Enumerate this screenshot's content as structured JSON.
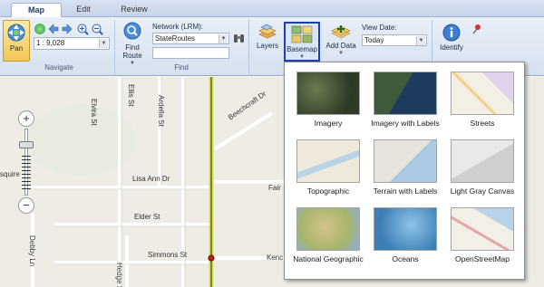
{
  "tabs": [
    {
      "label": "Map",
      "active": true
    },
    {
      "label": "Edit",
      "active": false
    },
    {
      "label": "Review",
      "active": false
    }
  ],
  "navigate": {
    "group_label": "Navigate",
    "pan_label": "Pan",
    "scale_value": "1 : 9,028"
  },
  "find": {
    "group_label": "Find",
    "network_label": "Network (LRM):",
    "network_value": "StateRoutes",
    "find_route_label": "Find Route",
    "route_value": ""
  },
  "toolbar": {
    "layers_label": "Layers",
    "basemap_label": "Basemap",
    "add_data_label": "Add Data",
    "view_date_label": "View Date:",
    "view_date_value": "Today",
    "identify_label": "Identify"
  },
  "map": {
    "streets": [
      "Elvira St",
      "Ardella St",
      "Ellis St",
      "Beechcraft Dr",
      "Lisa Ann Dr",
      "Elder St",
      "Simmons St",
      "Hedge St",
      "Debby Ln",
      "Fair",
      "Kenc",
      "squire"
    ]
  },
  "basemaps": [
    {
      "label": "Imagery"
    },
    {
      "label": "Imagery with Labels"
    },
    {
      "label": "Streets"
    },
    {
      "label": "Topographic"
    },
    {
      "label": "Terrain with Labels"
    },
    {
      "label": "Light Gray Canvas"
    },
    {
      "label": "National Geographic"
    },
    {
      "label": "Oceans"
    },
    {
      "label": "OpenStreetMap"
    }
  ]
}
